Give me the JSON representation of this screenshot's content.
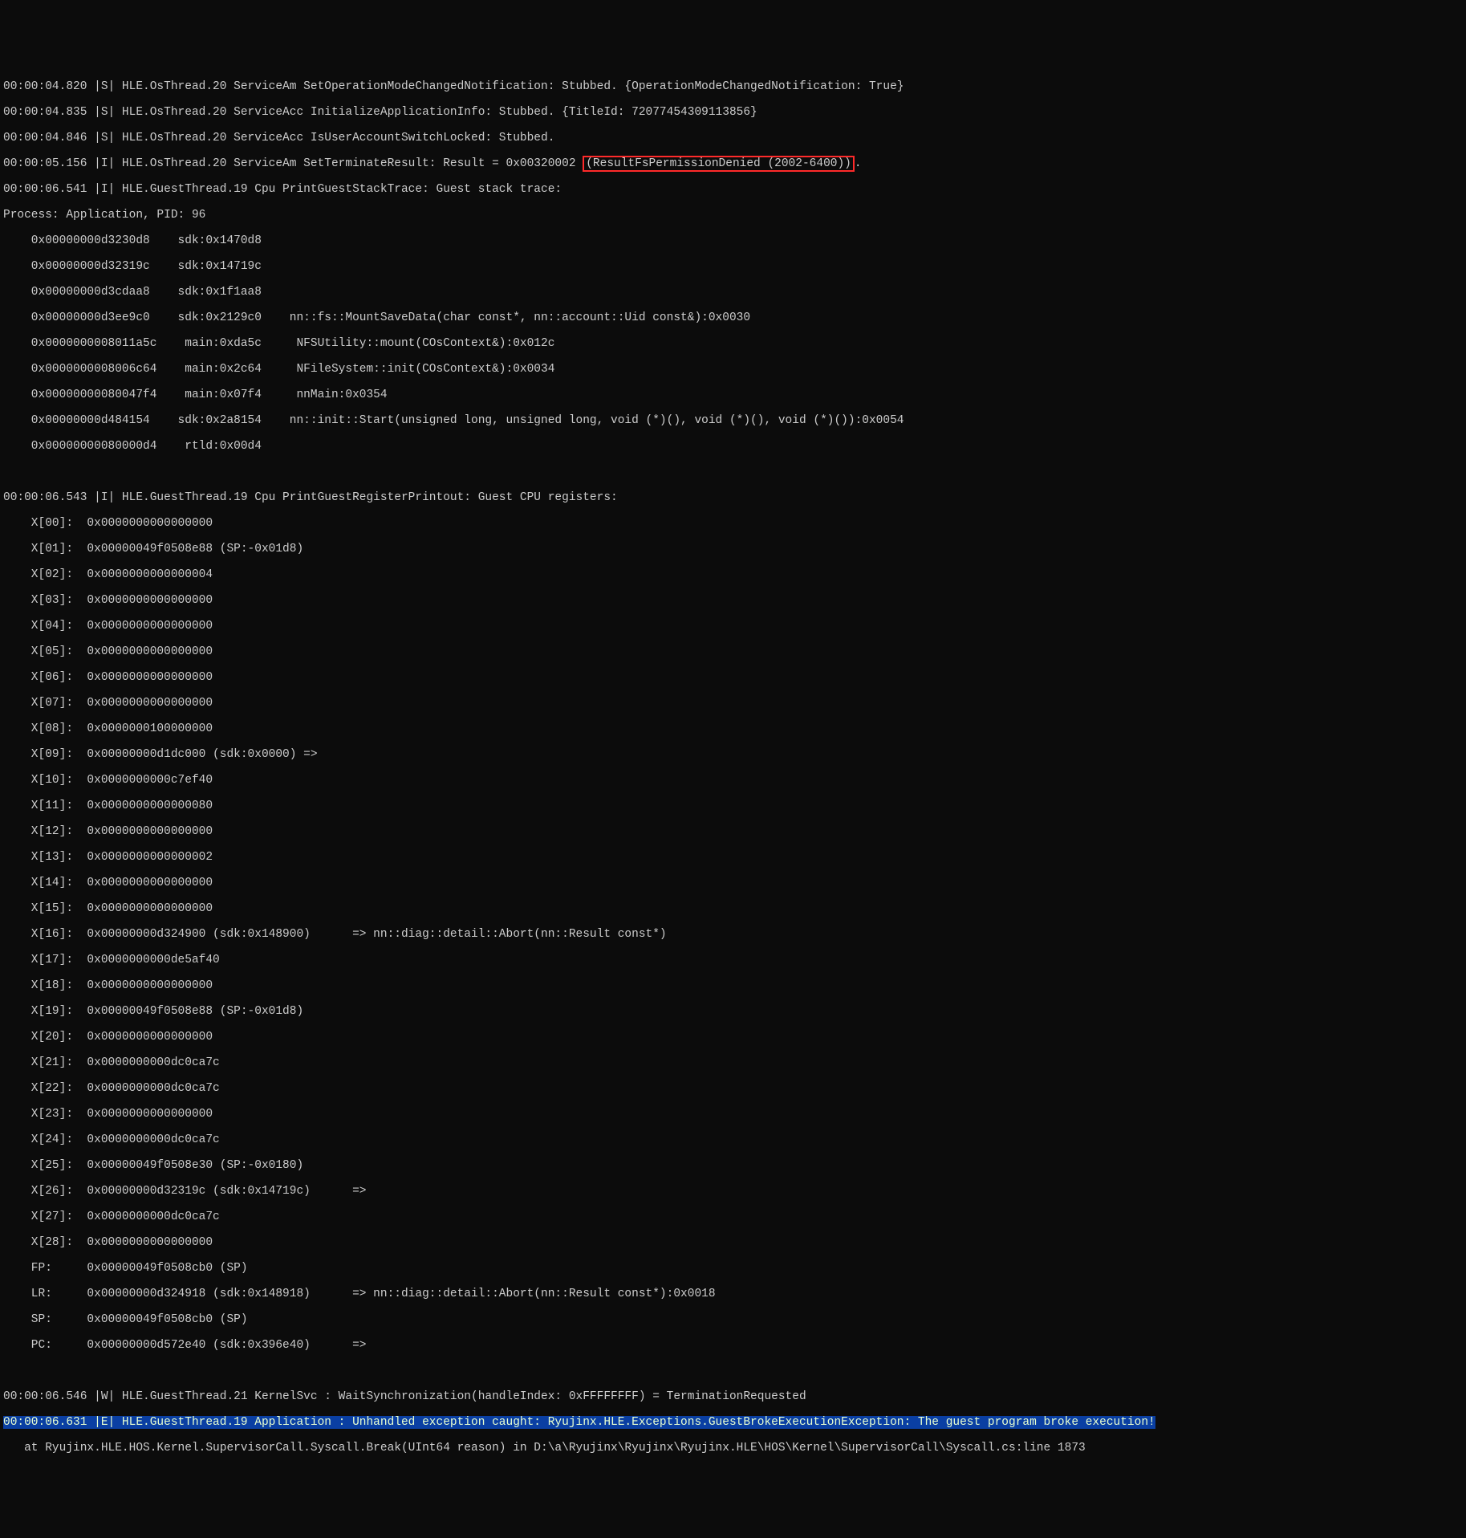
{
  "log": {
    "header_lines": [
      "00:00:04.820 |S| HLE.OsThread.20 ServiceAm SetOperationModeChangedNotification: Stubbed. {OperationModeChangedNotification: True}",
      "00:00:04.835 |S| HLE.OsThread.20 ServiceAcc InitializeApplicationInfo: Stubbed. {TitleId: 72077454309113856}",
      "00:00:04.846 |S| HLE.OsThread.20 ServiceAcc IsUserAccountSwitchLocked: Stubbed."
    ],
    "result_line_prefix": "00:00:05.156 |I| HLE.OsThread.20 ServiceAm SetTerminateResult: Result = 0x00320002 ",
    "result_highlight": "(ResultFsPermissionDenied (2002-6400))",
    "result_line_suffix": ".",
    "stack_trace_header": "00:00:06.541 |I| HLE.GuestThread.19 Cpu PrintGuestStackTrace: Guest stack trace:",
    "process_line": "Process: Application, PID: 96",
    "stack_frames": [
      "    0x00000000d3230d8    sdk:0x1470d8",
      "    0x00000000d32319c    sdk:0x14719c",
      "    0x00000000d3cdaa8    sdk:0x1f1aa8",
      "    0x00000000d3ee9c0    sdk:0x2129c0    nn::fs::MountSaveData(char const*, nn::account::Uid const&):0x0030",
      "    0x0000000008011a5c    main:0xda5c     NFSUtility::mount(COsContext&):0x012c",
      "    0x0000000008006c64    main:0x2c64     NFileSystem::init(COsContext&):0x0034",
      "    0x00000000080047f4    main:0x07f4     nnMain:0x0354",
      "    0x00000000d484154    sdk:0x2a8154    nn::init::Start(unsigned long, unsigned long, void (*)(), void (*)(), void (*)()):0x0054",
      "    0x00000000080000d4    rtld:0x00d4"
    ],
    "blank1": "",
    "blank2": "",
    "register_header": "00:00:06.543 |I| HLE.GuestThread.19 Cpu PrintGuestRegisterPrintout: Guest CPU registers:",
    "registers": [
      "    X[00]:  0x0000000000000000",
      "    X[01]:  0x00000049f0508e88 (SP:-0x01d8)",
      "    X[02]:  0x0000000000000004",
      "    X[03]:  0x0000000000000000",
      "    X[04]:  0x0000000000000000",
      "    X[05]:  0x0000000000000000",
      "    X[06]:  0x0000000000000000",
      "    X[07]:  0x0000000000000000",
      "    X[08]:  0x0000000100000000",
      "    X[09]:  0x00000000d1dc000 (sdk:0x0000) =>",
      "    X[10]:  0x0000000000c7ef40",
      "    X[11]:  0x0000000000000080",
      "    X[12]:  0x0000000000000000",
      "    X[13]:  0x0000000000000002",
      "    X[14]:  0x0000000000000000",
      "    X[15]:  0x0000000000000000",
      "    X[16]:  0x00000000d324900 (sdk:0x148900)      => nn::diag::detail::Abort(nn::Result const*)",
      "    X[17]:  0x0000000000de5af40",
      "    X[18]:  0x0000000000000000",
      "    X[19]:  0x00000049f0508e88 (SP:-0x01d8)",
      "    X[20]:  0x0000000000000000",
      "    X[21]:  0x0000000000dc0ca7c",
      "    X[22]:  0x0000000000dc0ca7c",
      "    X[23]:  0x0000000000000000",
      "    X[24]:  0x0000000000dc0ca7c",
      "    X[25]:  0x00000049f0508e30 (SP:-0x0180)",
      "    X[26]:  0x00000000d32319c (sdk:0x14719c)      =>",
      "    X[27]:  0x0000000000dc0ca7c",
      "    X[28]:  0x0000000000000000",
      "    FP:     0x00000049f0508cb0 (SP)",
      "    LR:     0x00000000d324918 (sdk:0x148918)      => nn::diag::detail::Abort(nn::Result const*):0x0018",
      "    SP:     0x00000049f0508cb0 (SP)",
      "    PC:     0x00000000d572e40 (sdk:0x396e40)      =>"
    ],
    "blank3": "",
    "blank4": "",
    "warn_line": "00:00:06.546 |W| HLE.GuestThread.21 KernelSvc : WaitSynchronization(handleIndex: 0xFFFFFFFF) = TerminationRequested",
    "error_line": "00:00:06.631 |E| HLE.GuestThread.19 Application : Unhandled exception caught: Ryujinx.HLE.Exceptions.GuestBrokeExecutionException: The guest program broke execution!",
    "trace_line": "   at Ryujinx.HLE.HOS.Kernel.SupervisorCall.Syscall.Break(UInt64 reason) in D:\\a\\Ryujinx\\Ryujinx\\Ryujinx.HLE\\HOS\\Kernel\\SupervisorCall\\Syscall.cs:line 1873"
  }
}
